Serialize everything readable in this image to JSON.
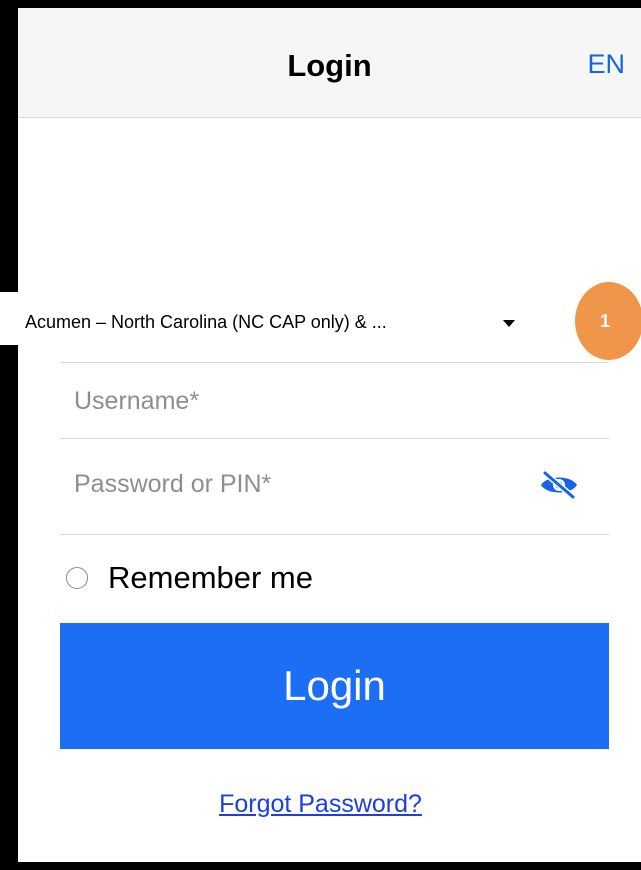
{
  "header": {
    "title": "Login",
    "language": "EN"
  },
  "provider": {
    "selected": "Acumen – North Carolina (NC CAP only) & ..."
  },
  "badge": {
    "number": "1"
  },
  "form": {
    "username_placeholder": "Username*",
    "username_value": "",
    "password_placeholder": "Password or PIN*",
    "password_value": "",
    "toggle_visibility_icon": "eye-slash-icon",
    "remember_label": "Remember me",
    "remember_checked": false,
    "login_label": "Login",
    "forgot_label": "Forgot Password?"
  },
  "colors": {
    "accent": "#1c6ff5",
    "link": "#1b3fe0",
    "badge": "#f0964b",
    "header_bg": "#f6f6f6"
  }
}
